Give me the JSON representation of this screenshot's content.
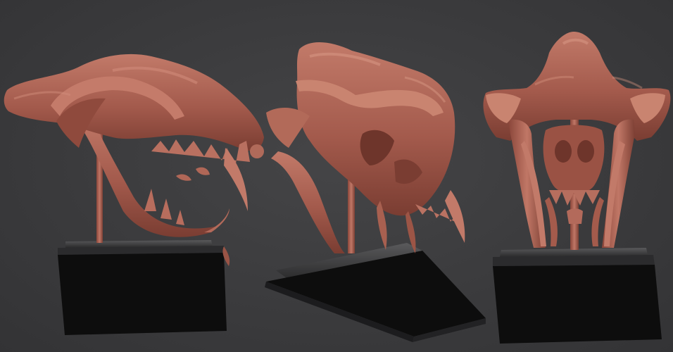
{
  "scene": {
    "colors": {
      "background": "#3b3b3d",
      "bone": "#a35a4c",
      "bone_highlight": "#c27a69",
      "bone_shadow": "#6e352b",
      "stand": "#0d0d0d",
      "stand_plate": "#4a4a4c"
    },
    "views": [
      "side",
      "three-quarter",
      "front"
    ]
  }
}
